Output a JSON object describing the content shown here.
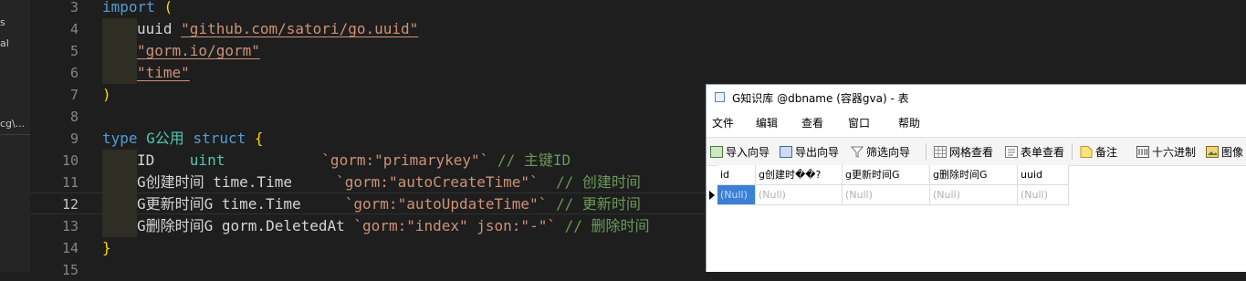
{
  "sidebar": {
    "fragments": [
      "s",
      "al",
      "cg\\..."
    ]
  },
  "editor": {
    "lines": [
      {
        "num": "3",
        "tokens": [
          {
            "t": "import",
            "c": "kw"
          },
          {
            "t": " ",
            "c": "pl"
          },
          {
            "t": "(",
            "c": "br"
          }
        ]
      },
      {
        "num": "4",
        "indent": 1,
        "tokens": [
          {
            "t": "uuid ",
            "c": "pl"
          },
          {
            "t": "\"github.com/satori/go.uuid\"",
            "c": "str u"
          }
        ]
      },
      {
        "num": "5",
        "indent": 1,
        "tokens": [
          {
            "t": "\"gorm.io/gorm\"",
            "c": "str u"
          }
        ]
      },
      {
        "num": "6",
        "indent": 1,
        "tokens": [
          {
            "t": "\"time\"",
            "c": "str u"
          }
        ]
      },
      {
        "num": "7",
        "tokens": [
          {
            "t": ")",
            "c": "br"
          }
        ]
      },
      {
        "num": "8",
        "tokens": []
      },
      {
        "num": "9",
        "tokens": [
          {
            "t": "type ",
            "c": "kw"
          },
          {
            "t": "G公用",
            "c": "ty"
          },
          {
            "t": " ",
            "c": "pl"
          },
          {
            "t": "struct",
            "c": "kw"
          },
          {
            "t": " ",
            "c": "pl"
          },
          {
            "t": "{",
            "c": "br"
          }
        ]
      },
      {
        "num": "10",
        "indent": 1,
        "tokens": [
          {
            "t": "ID    ",
            "c": "pl"
          },
          {
            "t": "uint",
            "c": "ty"
          },
          {
            "t": "           ",
            "c": "pl"
          },
          {
            "t": "`gorm:\"primarykey\"`",
            "c": "str"
          },
          {
            "t": " // 主键ID",
            "c": "cm"
          }
        ]
      },
      {
        "num": "11",
        "indent": 1,
        "tokens": [
          {
            "t": "G创建时间 time.Time     ",
            "c": "pl"
          },
          {
            "t": "`gorm:\"autoCreateTime\"`",
            "c": "str"
          },
          {
            "t": "  // 创建时间",
            "c": "cm"
          }
        ]
      },
      {
        "num": "12",
        "indent": 1,
        "active": true,
        "tokens": [
          {
            "t": "G更新时间G time.Time     ",
            "c": "pl"
          },
          {
            "t": "`gorm:\"autoUpdateTime\"`",
            "c": "str"
          },
          {
            "t": " // 更新时间",
            "c": "cm"
          }
        ]
      },
      {
        "num": "13",
        "indent": 1,
        "tokens": [
          {
            "t": "G删除时间G gorm.DeletedAt ",
            "c": "pl"
          },
          {
            "t": "`gorm:\"index\" json:\"-\"`",
            "c": "str"
          },
          {
            "t": " // 删除时间",
            "c": "cm"
          }
        ]
      },
      {
        "num": "14",
        "tokens": [
          {
            "t": "}",
            "c": "br"
          }
        ]
      },
      {
        "num": "15",
        "tokens": []
      }
    ]
  },
  "table_window": {
    "title": "G知识库 @dbname (容器gva) - 表",
    "menu": [
      "文件",
      "编辑",
      "查看",
      "窗口",
      "帮助"
    ],
    "toolbar": [
      {
        "label": "导入向导",
        "icon": "import-wizard-icon"
      },
      {
        "label": "导出向导",
        "icon": "export-wizard-icon"
      },
      {
        "label": "筛选向导",
        "icon": "filter-wizard-icon"
      },
      {
        "label": "网格查看",
        "icon": "grid-view-icon"
      },
      {
        "label": "表单查看",
        "icon": "form-view-icon"
      },
      {
        "label": "备注",
        "icon": "memo-icon"
      },
      {
        "label": "十六进制",
        "icon": "hex-icon"
      },
      {
        "label": "图像",
        "icon": "image-icon"
      }
    ],
    "columns": [
      "id",
      "g创建时��?",
      "g更新时间G",
      "g删除时间G",
      "uuid"
    ],
    "rows": [
      [
        "(Null)",
        "(Null)",
        "(Null)",
        "(Null)",
        "(Null)"
      ]
    ],
    "colors": {
      "selected": "#3b7fd6",
      "null_text": "#b0b0b0"
    }
  }
}
